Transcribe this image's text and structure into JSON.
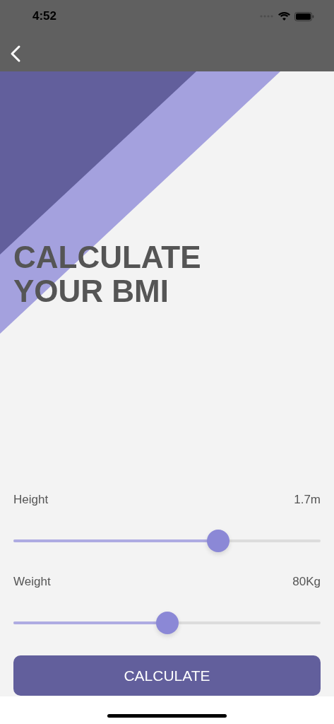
{
  "status_bar": {
    "time": "4:52"
  },
  "title": "CALCULATE YOUR BMI",
  "sliders": [
    {
      "label": "Height",
      "reading": "1.7m",
      "level": 0.667
    },
    {
      "label": "Weight",
      "reading": "80Kg",
      "level": 0.5
    }
  ],
  "button": {
    "label": "CALCULATE"
  }
}
